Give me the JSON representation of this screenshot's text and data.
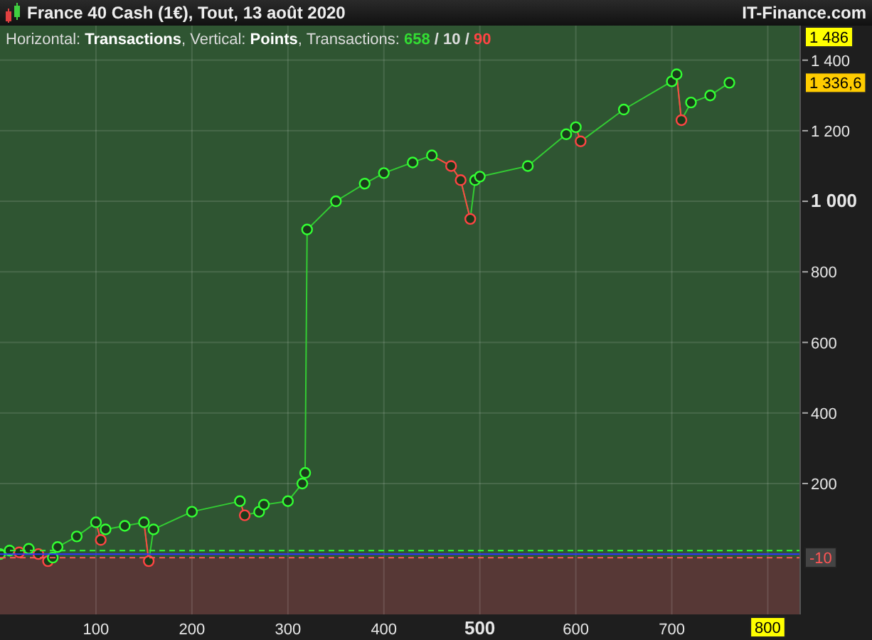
{
  "header": {
    "title": "France 40 Cash (1€), Tout, 13 août 2020",
    "brand": "IT-Finance.com"
  },
  "legend": [
    {
      "kind": "plain",
      "text": "Horizontal: "
    },
    {
      "kind": "bold",
      "text": "Transactions"
    },
    {
      "kind": "plain",
      "text": ", Vertical: "
    },
    {
      "kind": "bold",
      "text": "Points"
    },
    {
      "kind": "plain",
      "text": ", Transactions: "
    },
    {
      "kind": "win",
      "text": "658"
    },
    {
      "kind": "neutral",
      "text": " / 10 / "
    },
    {
      "kind": "loss",
      "text": "90"
    }
  ],
  "chart_data": {
    "type": "line",
    "grid": true,
    "x": [
      0,
      10,
      20,
      30,
      40,
      50,
      55,
      60,
      80,
      100,
      105,
      110,
      130,
      150,
      155,
      160,
      200,
      250,
      255,
      270,
      275,
      300,
      315,
      318,
      320,
      350,
      380,
      400,
      430,
      450,
      470,
      480,
      490,
      495,
      500,
      550,
      590,
      600,
      605,
      650,
      700,
      705,
      710,
      720,
      740,
      760
    ],
    "series": [
      {
        "color": "#33cc33",
        "marker": "circle",
        "values": [
          0,
          10,
          5,
          15,
          0,
          -20,
          -10,
          20,
          50,
          90,
          40,
          70,
          80,
          90,
          -20,
          70,
          120,
          150,
          110,
          120,
          140,
          150,
          200,
          230,
          920,
          1000,
          1050,
          1080,
          1110,
          1130,
          1100,
          1060,
          950,
          1060,
          1070,
          1100,
          1190,
          1210,
          1170,
          1260,
          1340,
          1360,
          1230,
          1280,
          1300,
          1336
        ]
      }
    ],
    "xlim": [
      0,
      833
    ],
    "ylim": [
      -171,
      1498
    ],
    "xticks": [
      {
        "value": 100,
        "label": "100"
      },
      {
        "value": 200,
        "label": "200"
      },
      {
        "value": 300,
        "label": "300"
      },
      {
        "value": 400,
        "label": "400"
      },
      {
        "value": 500,
        "label": "500"
      },
      {
        "value": 600,
        "label": "600"
      },
      {
        "value": 700,
        "label": "700"
      },
      {
        "value": 800,
        "label": "800"
      }
    ],
    "yticks": [
      {
        "value": 200,
        "label": "200"
      },
      {
        "value": 400,
        "label": "400"
      },
      {
        "value": 600,
        "label": "600"
      },
      {
        "value": 800,
        "label": "800"
      },
      {
        "value": 1000,
        "label": "1 000"
      },
      {
        "value": 1200,
        "label": "1 200"
      },
      {
        "value": 1400,
        "label": "1 400"
      }
    ],
    "annotations": [
      "1 486",
      "1 336,6",
      "-10"
    ]
  }
}
